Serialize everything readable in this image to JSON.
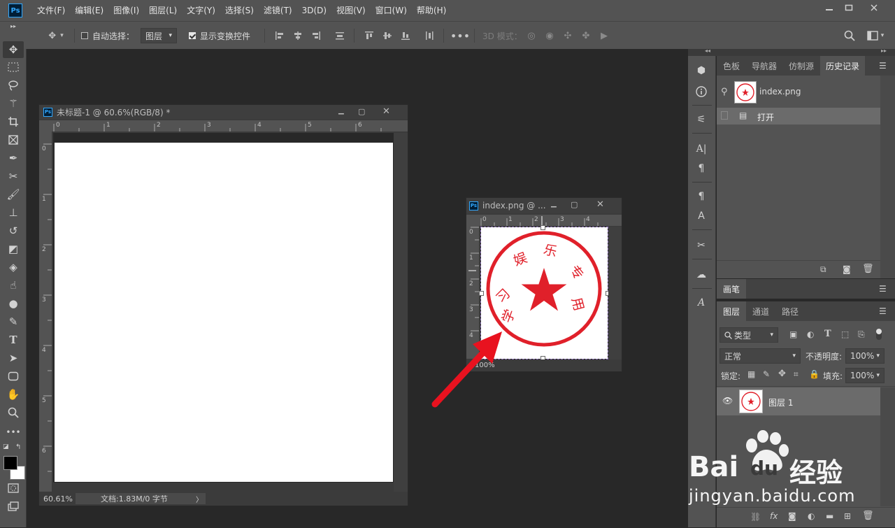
{
  "menubar": {
    "items": [
      "文件(F)",
      "编辑(E)",
      "图像(I)",
      "图层(L)",
      "文字(Y)",
      "选择(S)",
      "滤镜(T)",
      "3D(D)",
      "视图(V)",
      "窗口(W)",
      "帮助(H)"
    ],
    "logo": "Ps"
  },
  "options": {
    "auto_select_label": "自动选择：",
    "auto_select_value": "图层",
    "show_transform_label": "显示变换控件",
    "mode_3d_label": "3D 模式："
  },
  "doc1": {
    "title": "未标题-1 @ 60.6%(RGB/8) *",
    "zoom": "60.61%",
    "docinfo": "文档:1.83M/0 字节",
    "ruler_top": [
      "0",
      "1",
      "2",
      "3",
      "4",
      "5",
      "6"
    ],
    "ruler_left": [
      "0",
      "1",
      "2",
      "3",
      "4",
      "5",
      "6"
    ]
  },
  "doc2": {
    "title": "index.png @ ...",
    "zoom": "100%",
    "ruler_top": [
      "0",
      "1",
      "2",
      "3",
      "4"
    ],
    "ruler_left": [
      "0",
      "1",
      "2",
      "3",
      "4"
    ],
    "stamp_chars": [
      "学",
      "习",
      "娱",
      "乐",
      "专",
      "用"
    ]
  },
  "history_panel": {
    "tabs": [
      "色板",
      "导航器",
      "仿制源",
      "历史记录"
    ],
    "snapshot_name": "index.png",
    "step_open": "打开"
  },
  "brush_panel": {
    "title": "画笔"
  },
  "layers_panel": {
    "tabs": [
      "图层",
      "通道",
      "路径"
    ],
    "filter_kind": "类型",
    "blend_mode": "正常",
    "opacity_label": "不透明度:",
    "opacity_value": "100%",
    "lock_label": "锁定:",
    "fill_label": "填充:",
    "fill_value": "100%",
    "layer_name": "图层 1"
  },
  "watermark": {
    "brand_left": "Bai",
    "brand_right": "du",
    "brand_cn": "经验",
    "url": "jingyan.baidu.com"
  },
  "colors": {
    "ui_bg": "#535353",
    "workspace": "#282828",
    "stamp_red": "#e0202a",
    "arrow_red": "#e8121f",
    "accent_blue": "#31a8ff"
  }
}
